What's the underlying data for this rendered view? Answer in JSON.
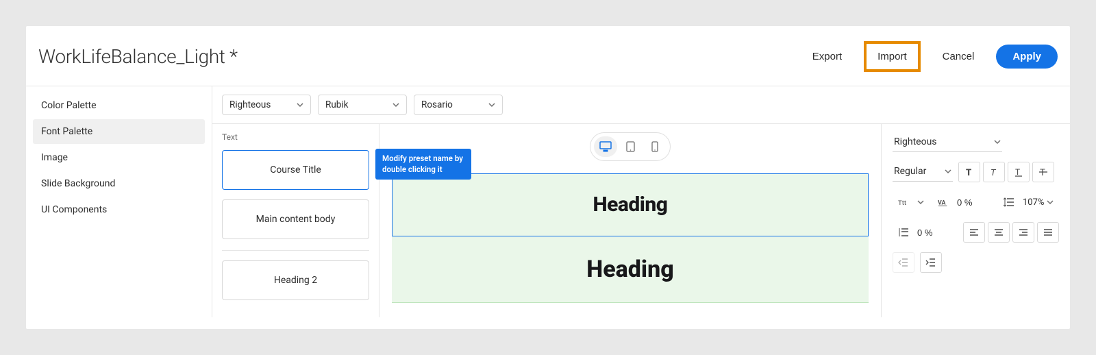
{
  "header": {
    "title": "WorkLifeBalance_Light *",
    "export": "Export",
    "import": "Import",
    "cancel": "Cancel",
    "apply": "Apply"
  },
  "sidebar": {
    "items": [
      {
        "label": "Color Palette"
      },
      {
        "label": "Font Palette"
      },
      {
        "label": "Image"
      },
      {
        "label": "Slide Background"
      },
      {
        "label": "UI Components"
      }
    ],
    "selected": 1
  },
  "fontbar": {
    "font1": "Righteous",
    "font2": "Rubik",
    "font3": "Rosario"
  },
  "presets": {
    "section": "Text",
    "items": [
      {
        "label": "Course Title"
      },
      {
        "label": "Main content body"
      },
      {
        "label": "Heading 2"
      }
    ],
    "selected": 0,
    "tooltip": "Modify preset name by double clicking it"
  },
  "preview": {
    "heading1": "Heading",
    "heading2": "Heading"
  },
  "inspector": {
    "font": "Righteous",
    "weight": "Regular",
    "tracking": "0 %",
    "lineheight": "107%",
    "paragraph_spacing": "0 %"
  }
}
